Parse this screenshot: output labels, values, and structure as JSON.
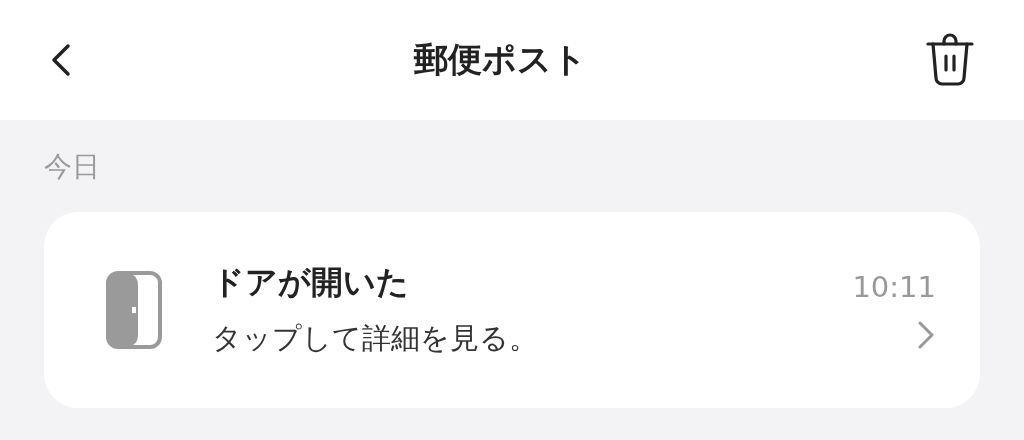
{
  "header": {
    "title": "郵便ポスト"
  },
  "section": {
    "label": "今日"
  },
  "notifications": [
    {
      "title": "ドアが開いた",
      "subtitle": "タップして詳細を見る。",
      "time": "10:11"
    }
  ]
}
